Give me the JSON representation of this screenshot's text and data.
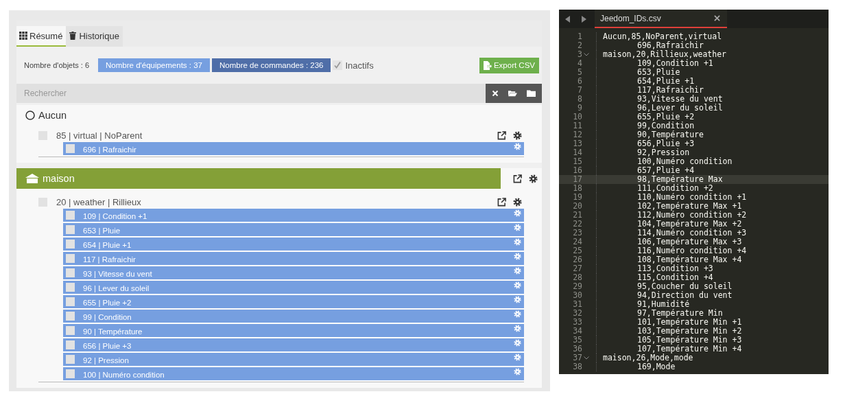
{
  "tabs": [
    {
      "label": "Résumé",
      "selected": true
    },
    {
      "label": "Historique",
      "selected": false
    }
  ],
  "stats": {
    "objects": "Nombre d'objets : 6",
    "equipments": "Nombre d'équipements : 37",
    "commands": "Nombre de commandes : 236"
  },
  "inactive": {
    "label": "Inactifs",
    "checked": true
  },
  "export_button": "Export CSV",
  "search": {
    "placeholder": "Rechercher"
  },
  "objects": [
    {
      "name": "Aucun",
      "kind": "none",
      "equipments": [
        {
          "label": "85 | virtual | NoParent",
          "checked": false,
          "commands": [
            {
              "label": "696 | Rafraichir",
              "checked": false
            }
          ]
        }
      ]
    },
    {
      "name": "maison",
      "kind": "house",
      "equipments": [
        {
          "label": "20 | weather | Rillieux",
          "checked": false,
          "commands": [
            {
              "label": "109 | Condition +1",
              "checked": false
            },
            {
              "label": "653 | Pluie",
              "checked": false
            },
            {
              "label": "654 | Pluie +1",
              "checked": false
            },
            {
              "label": "117 | Rafraichir",
              "checked": false
            },
            {
              "label": "93 | Vitesse du vent",
              "checked": false
            },
            {
              "label": "96 | Lever du soleil",
              "checked": false
            },
            {
              "label": "655 | Pluie +2",
              "checked": false
            },
            {
              "label": "99 | Condition",
              "checked": false
            },
            {
              "label": "90 | Température",
              "checked": false
            },
            {
              "label": "656 | Pluie +3",
              "checked": false
            },
            {
              "label": "92 | Pression",
              "checked": false
            },
            {
              "label": "100 | Numéro condition",
              "checked": false
            }
          ]
        }
      ]
    }
  ],
  "editor": {
    "file": "Jeedom_IDs.csv",
    "lines": [
      {
        "number": "1",
        "text": "Aucun,85,NoParent,virtual",
        "kind": "parent",
        "foldable": false,
        "selected": false
      },
      {
        "number": "2",
        "text": "696,Rafraichir",
        "kind": "child",
        "foldable": false,
        "selected": false
      },
      {
        "number": "3",
        "text": "maison,20,Rillieux,weather",
        "kind": "parent",
        "foldable": true,
        "selected": false
      },
      {
        "number": "4",
        "text": "109,Condition +1",
        "kind": "child",
        "foldable": false,
        "selected": false
      },
      {
        "number": "5",
        "text": "653,Pluie",
        "kind": "child",
        "foldable": false,
        "selected": false
      },
      {
        "number": "6",
        "text": "654,Pluie +1",
        "kind": "child",
        "foldable": false,
        "selected": false
      },
      {
        "number": "7",
        "text": "117,Rafraichir",
        "kind": "child",
        "foldable": false,
        "selected": false
      },
      {
        "number": "8",
        "text": "93,Vitesse du vent",
        "kind": "child",
        "foldable": false,
        "selected": false
      },
      {
        "number": "9",
        "text": "96,Lever du soleil",
        "kind": "child",
        "foldable": false,
        "selected": false
      },
      {
        "number": "10",
        "text": "655,Pluie +2",
        "kind": "child",
        "foldable": false,
        "selected": false
      },
      {
        "number": "11",
        "text": "99,Condition",
        "kind": "child",
        "foldable": false,
        "selected": false
      },
      {
        "number": "12",
        "text": "90,Température",
        "kind": "child",
        "foldable": false,
        "selected": false
      },
      {
        "number": "13",
        "text": "656,Pluie +3",
        "kind": "child",
        "foldable": false,
        "selected": false
      },
      {
        "number": "14",
        "text": "92,Pression",
        "kind": "child",
        "foldable": false,
        "selected": false
      },
      {
        "number": "15",
        "text": "100,Numéro condition",
        "kind": "child",
        "foldable": false,
        "selected": false
      },
      {
        "number": "16",
        "text": "657,Pluie +4",
        "kind": "child",
        "foldable": false,
        "selected": false
      },
      {
        "number": "17",
        "text": "98,Température Max",
        "kind": "child",
        "foldable": false,
        "selected": true
      },
      {
        "number": "18",
        "text": "111,Condition +2",
        "kind": "child",
        "foldable": false,
        "selected": false
      },
      {
        "number": "19",
        "text": "110,Numéro condition +1",
        "kind": "child",
        "foldable": false,
        "selected": false
      },
      {
        "number": "20",
        "text": "102,Température Max +1",
        "kind": "child",
        "foldable": false,
        "selected": false
      },
      {
        "number": "21",
        "text": "112,Numéro condition +2",
        "kind": "child",
        "foldable": false,
        "selected": false
      },
      {
        "number": "22",
        "text": "104,Température Max +2",
        "kind": "child",
        "foldable": false,
        "selected": false
      },
      {
        "number": "23",
        "text": "114,Numéro condition +3",
        "kind": "child",
        "foldable": false,
        "selected": false
      },
      {
        "number": "24",
        "text": "106,Température Max +3",
        "kind": "child",
        "foldable": false,
        "selected": false
      },
      {
        "number": "25",
        "text": "116,Numéro condition +4",
        "kind": "child",
        "foldable": false,
        "selected": false
      },
      {
        "number": "26",
        "text": "108,Température Max +4",
        "kind": "child",
        "foldable": false,
        "selected": false
      },
      {
        "number": "27",
        "text": "113,Condition +3",
        "kind": "child",
        "foldable": false,
        "selected": false
      },
      {
        "number": "28",
        "text": "115,Condition +4",
        "kind": "child",
        "foldable": false,
        "selected": false
      },
      {
        "number": "29",
        "text": "95,Coucher du soleil",
        "kind": "child",
        "foldable": false,
        "selected": false
      },
      {
        "number": "30",
        "text": "94,Direction du vent",
        "kind": "child",
        "foldable": false,
        "selected": false
      },
      {
        "number": "31",
        "text": "91,Humidité",
        "kind": "child",
        "foldable": false,
        "selected": false
      },
      {
        "number": "32",
        "text": "97,Température Min",
        "kind": "child",
        "foldable": false,
        "selected": false
      },
      {
        "number": "33",
        "text": "101,Température Min +1",
        "kind": "child",
        "foldable": false,
        "selected": false
      },
      {
        "number": "34",
        "text": "103,Température Min +2",
        "kind": "child",
        "foldable": false,
        "selected": false
      },
      {
        "number": "35",
        "text": "105,Température Min +3",
        "kind": "child",
        "foldable": false,
        "selected": false
      },
      {
        "number": "36",
        "text": "107,Température Min +4",
        "kind": "child",
        "foldable": false,
        "selected": false
      },
      {
        "number": "37",
        "text": "maison,26,Mode,mode",
        "kind": "parent",
        "foldable": true,
        "selected": false
      },
      {
        "number": "38",
        "text": "169,Mode",
        "kind": "child",
        "foldable": false,
        "selected": false
      }
    ]
  }
}
